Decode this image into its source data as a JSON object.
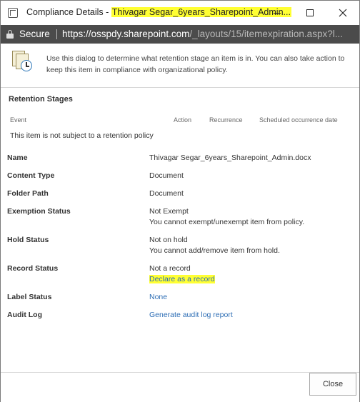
{
  "titlebar": {
    "prefix": "Compliance Details - ",
    "highlight": "Thivagar Segar_6years_Sharepoint_Admin..."
  },
  "addressbar": {
    "secure_label": "Secure",
    "url_host": "https://osspdy.sharepoint.com",
    "url_path": "/_layouts/15/itemexpiration.aspx?l..."
  },
  "info": {
    "text": "Use this dialog to determine what retention stage an item is in. You can also take action to keep this item in compliance with organizational policy."
  },
  "retention": {
    "title": "Retention Stages",
    "columns": [
      "Event",
      "Action",
      "Recurrence",
      "Scheduled occurrence date"
    ],
    "empty_message": "This item is not subject to a retention policy"
  },
  "details": {
    "name": {
      "label": "Name",
      "value": "Thivagar Segar_6years_Sharepoint_Admin.docx"
    },
    "content_type": {
      "label": "Content Type",
      "value": "Document"
    },
    "folder_path": {
      "label": "Folder Path",
      "value": "Document"
    },
    "exemption": {
      "label": "Exemption Status",
      "value": "Not Exempt",
      "note": "You cannot exempt/unexempt item from policy."
    },
    "hold": {
      "label": "Hold Status",
      "value": "Not on hold",
      "note": "You cannot add/remove item from hold."
    },
    "record": {
      "label": "Record Status",
      "value": "Not a record",
      "link": "Declare as a record"
    },
    "label_status": {
      "label": "Label Status",
      "link": "None"
    },
    "audit": {
      "label": "Audit Log",
      "link": "Generate audit log report"
    }
  },
  "footer": {
    "close_label": "Close"
  },
  "colors": {
    "highlight": "#ffff33",
    "link": "#2e6eb5",
    "addressbar_bg": "#4b4b4b"
  }
}
